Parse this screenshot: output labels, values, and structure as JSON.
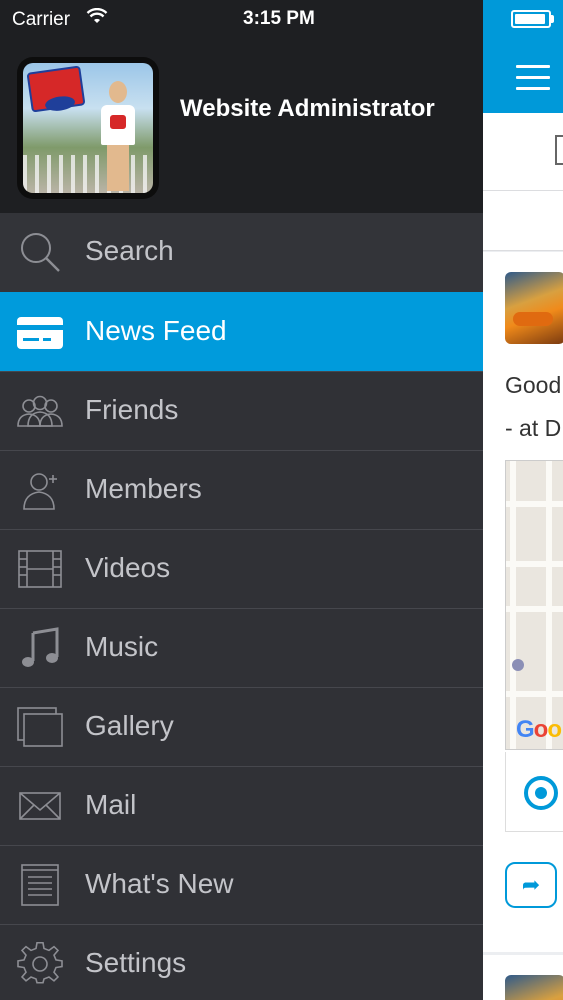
{
  "status_bar": {
    "carrier": "Carrier",
    "time": "3:15 PM"
  },
  "profile": {
    "name": "Website Administrator"
  },
  "menu": {
    "items": [
      {
        "label": "Search",
        "icon": "search-icon"
      },
      {
        "label": "News Feed",
        "icon": "news-feed-icon",
        "active": true
      },
      {
        "label": "Friends",
        "icon": "friends-icon"
      },
      {
        "label": "Members",
        "icon": "members-icon"
      },
      {
        "label": "Videos",
        "icon": "videos-icon"
      },
      {
        "label": "Music",
        "icon": "music-icon"
      },
      {
        "label": "Gallery",
        "icon": "gallery-icon"
      },
      {
        "label": "Mail",
        "icon": "mail-icon"
      },
      {
        "label": "What's New",
        "icon": "whats-new-icon"
      },
      {
        "label": "Settings",
        "icon": "settings-icon"
      }
    ]
  },
  "feed": {
    "post_text_line1": "Good",
    "post_text_line2": "- at D",
    "map_logo": {
      "g": "G",
      "o1": "o",
      "o2": "o"
    }
  },
  "colors": {
    "accent": "#009bdc",
    "drawer_bg": "#303136",
    "header_bg": "#1e1f22",
    "label": "#c3c4c9"
  }
}
